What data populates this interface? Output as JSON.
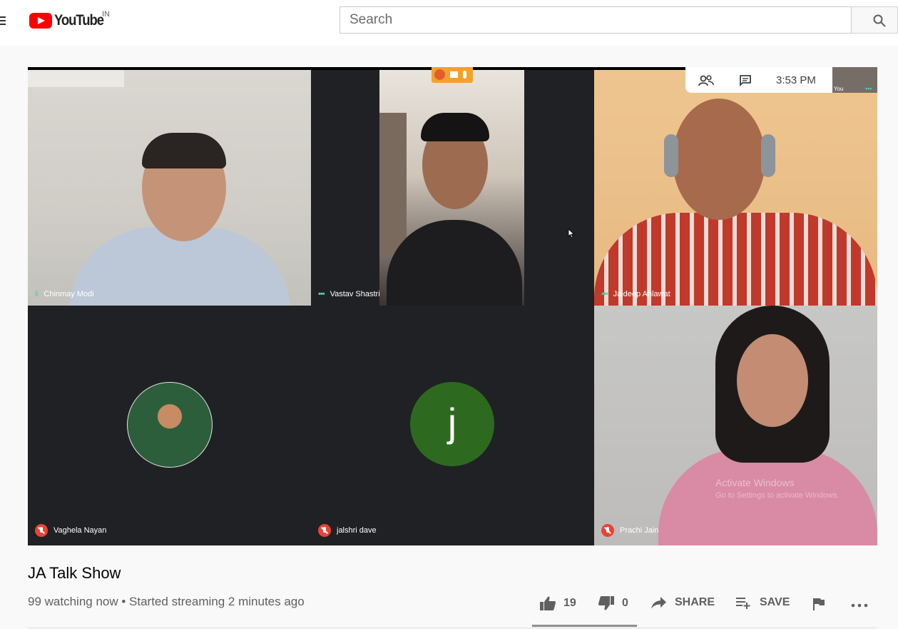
{
  "header": {
    "logo_text": "YouTube",
    "country_code": "IN",
    "search_placeholder": "Search"
  },
  "meeting": {
    "time": "3:53 PM",
    "self_label": "You",
    "participants": [
      {
        "name": "Chinmay Modi",
        "status": "speaking"
      },
      {
        "name": "Vastav Shastri",
        "status": "unmuted"
      },
      {
        "name": "Jaideep Ahlawat",
        "status": "unmuted"
      },
      {
        "name": "Vaghela Nayan",
        "status": "muted"
      },
      {
        "name": "jalshri dave",
        "status": "muted",
        "initial": "j"
      },
      {
        "name": "Prachi Jain",
        "status": "muted"
      }
    ],
    "watermark_line1": "Activate Windows",
    "watermark_line2": "Go to Settings to activate Windows."
  },
  "video": {
    "title": "JA Talk Show",
    "meta": "99 watching now • Started streaming 2 minutes ago",
    "likes": "19",
    "dislikes": "0",
    "share_label": "SHARE",
    "save_label": "SAVE"
  },
  "colors": {
    "brand_red": "#ff0000",
    "avatar_green": "#2d6a1f",
    "meet_dark": "#202124"
  }
}
